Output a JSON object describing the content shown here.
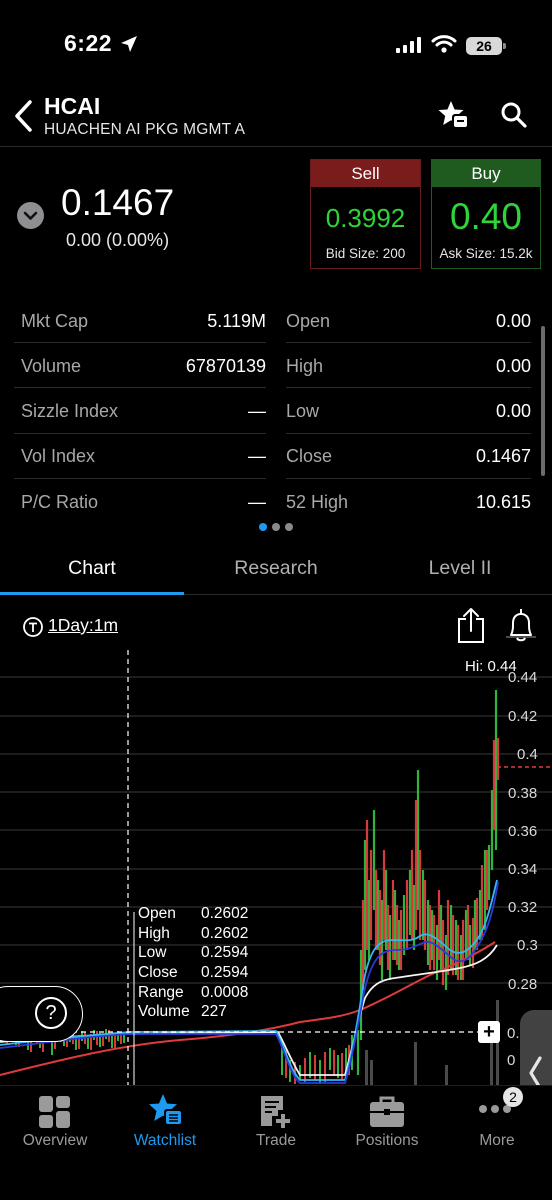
{
  "status_bar": {
    "time": "6:22",
    "battery": "26"
  },
  "header": {
    "ticker": "HCAI",
    "company": "HUACHEN AI PKG MGMT A"
  },
  "quote": {
    "last": "0.1467",
    "change": "0.00 (0.00%)"
  },
  "sell": {
    "label": "Sell",
    "price": "0.3992",
    "size": "Bid Size: 200"
  },
  "buy": {
    "label": "Buy",
    "price": "0.40",
    "size": "Ask Size: 15.2k"
  },
  "stats": {
    "left": [
      {
        "label": "Mkt Cap",
        "value": "5.119M"
      },
      {
        "label": "Volume",
        "value": "67870139"
      },
      {
        "label": "Sizzle Index",
        "value": "—"
      },
      {
        "label": "Vol Index",
        "value": "—"
      },
      {
        "label": "P/C Ratio",
        "value": "—"
      }
    ],
    "right": [
      {
        "label": "Open",
        "value": "0.00"
      },
      {
        "label": "High",
        "value": "0.00"
      },
      {
        "label": "Low",
        "value": "0.00"
      },
      {
        "label": "Close",
        "value": "0.1467"
      },
      {
        "label": "52 High",
        "value": "10.615"
      }
    ]
  },
  "tabs": [
    "Chart",
    "Research",
    "Level II"
  ],
  "chart": {
    "interval": "1Day:1m",
    "hi_label": "Hi: 0.44",
    "y_labels": [
      "0.44",
      "0.42",
      "0.4",
      "0.38",
      "0.36",
      "0.34",
      "0.32",
      "0.3",
      "0.28",
      "0.",
      "0"
    ],
    "tooltip": {
      "labels": [
        "Open",
        "High",
        "Low",
        "Close",
        "Range",
        "Volume"
      ],
      "values": [
        "0.2602",
        "0.2602",
        "0.2594",
        "0.2594",
        "0.0008",
        "227"
      ]
    },
    "help": "?",
    "crosshair_plus": "+"
  },
  "nav": {
    "items": [
      {
        "label": "Overview",
        "icon": "overview-grid-icon"
      },
      {
        "label": "Watchlist",
        "icon": "watchlist-star-icon"
      },
      {
        "label": "Trade",
        "icon": "trade-ticket-icon"
      },
      {
        "label": "Positions",
        "icon": "briefcase-icon"
      },
      {
        "label": "More",
        "icon": "more-dots-icon"
      }
    ],
    "more_badge": "2"
  },
  "colors": {
    "accent": "#1e9bf0",
    "up": "#2fd43a",
    "down": "#e03a3a",
    "sell_bg": "#7b1c1c",
    "buy_bg": "#1f5a1f"
  }
}
